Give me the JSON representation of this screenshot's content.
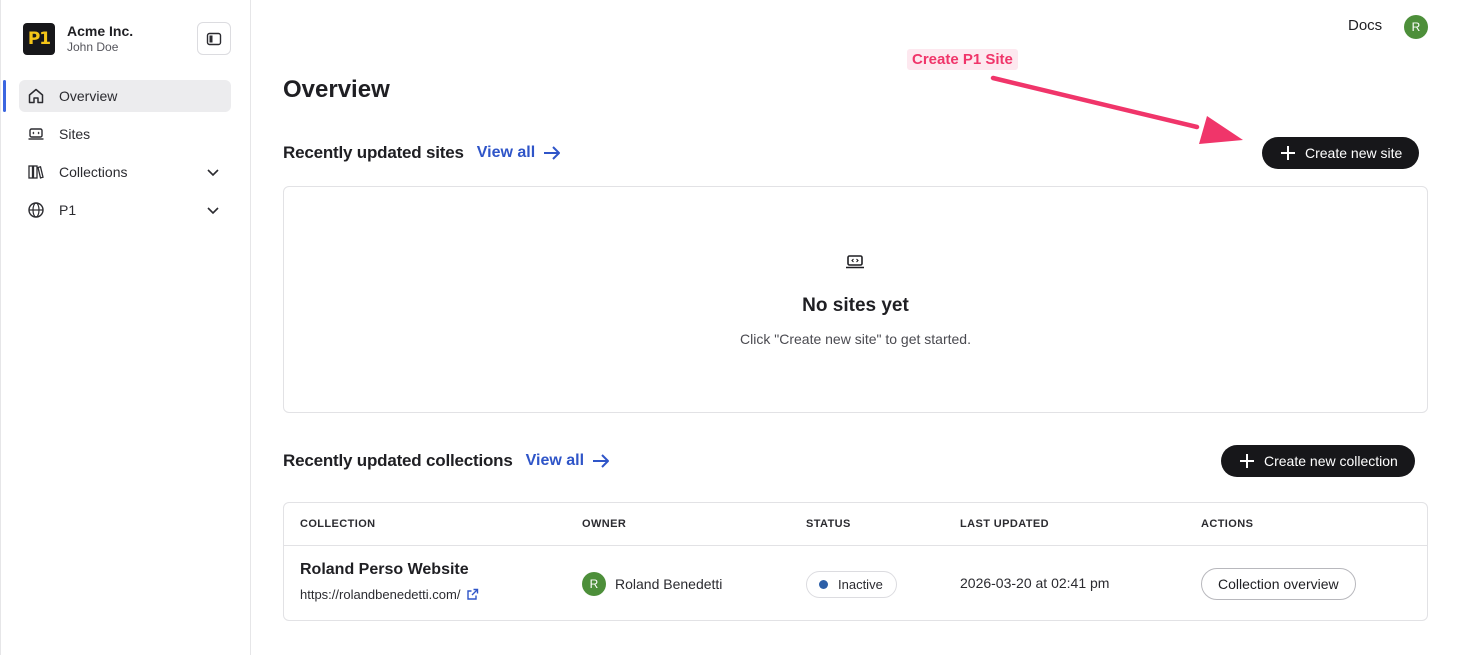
{
  "org": {
    "logo_text": "P1",
    "name": "Acme Inc.",
    "user": "John Doe"
  },
  "sidebar": {
    "items": [
      {
        "label": "Overview",
        "icon": "home-icon",
        "active": true
      },
      {
        "label": "Sites",
        "icon": "site-icon"
      },
      {
        "label": "Collections",
        "icon": "books-icon",
        "expandable": true
      },
      {
        "label": "P1",
        "icon": "globe-icon",
        "expandable": true
      }
    ]
  },
  "header": {
    "docs_label": "Docs",
    "avatar_initial": "R"
  },
  "page": {
    "title": "Overview"
  },
  "annotation": {
    "label": "Create P1 Site",
    "color": "#f0356a"
  },
  "sites_section": {
    "title": "Recently updated sites",
    "view_all": "View all",
    "create_button": "Create new site",
    "empty_title": "No sites yet",
    "empty_subtitle": "Click \"Create new site\" to get started."
  },
  "collections_section": {
    "title": "Recently updated collections",
    "view_all": "View all",
    "create_button": "Create new collection",
    "columns": [
      "COLLECTION",
      "OWNER",
      "STATUS",
      "LAST UPDATED",
      "ACTIONS"
    ],
    "rows": [
      {
        "name": "Roland Perso Website",
        "url": "https://rolandbenedetti.com/",
        "owner_initial": "R",
        "owner": "Roland Benedetti",
        "status": "Inactive",
        "last_updated": "2026-03-20 at 02:41 pm",
        "action": "Collection overview"
      }
    ]
  },
  "colors": {
    "accent": "#2f55c8",
    "dark_button": "#17171a",
    "avatar": "#4d8f3a",
    "status_dot": "#2d5fa8"
  }
}
